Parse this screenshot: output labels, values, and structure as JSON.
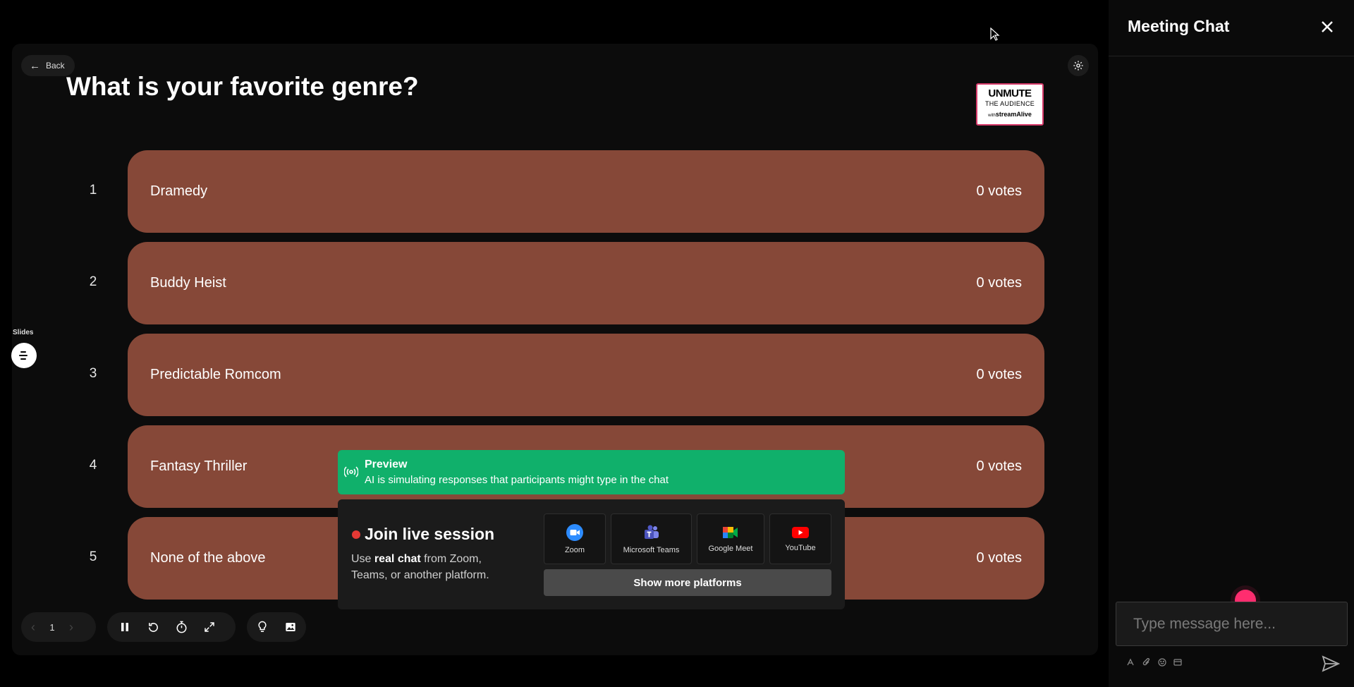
{
  "presentation": {
    "back_label": "Back",
    "question": "What is your favorite genre?",
    "logo": {
      "line1": "UNMUTE",
      "line2": "THE AUDIENCE",
      "line3_prefix": "with",
      "line3": "streamAlive"
    },
    "options": [
      {
        "number": "1",
        "label": "Dramedy",
        "votes": "0 votes"
      },
      {
        "number": "2",
        "label": "Buddy Heist",
        "votes": "0 votes"
      },
      {
        "number": "3",
        "label": "Predictable Romcom",
        "votes": "0 votes"
      },
      {
        "number": "4",
        "label": "Fantasy Thriller",
        "votes": "0 votes"
      },
      {
        "number": "5",
        "label": "None of the above",
        "votes": "0 votes"
      }
    ],
    "slides_label": "Slides",
    "page_number": "1"
  },
  "preview_banner": {
    "title": "Preview",
    "text": "AI is simulating responses that participants might type in the chat"
  },
  "join_panel": {
    "title": "Join live session",
    "desc_prefix": "Use ",
    "desc_bold": "real chat",
    "desc_suffix": " from Zoom, Teams, or another platform.",
    "platforms": [
      {
        "label": "Zoom",
        "icon": "zoom-icon"
      },
      {
        "label": "Microsoft Teams",
        "icon": "teams-icon"
      },
      {
        "label": "Google Meet",
        "icon": "google-meet-icon"
      },
      {
        "label": "YouTube",
        "icon": "youtube-icon"
      }
    ],
    "more_label": "Show more platforms"
  },
  "chat": {
    "title": "Meeting Chat",
    "input_placeholder": "Type message here..."
  },
  "colors": {
    "option_bar": "#864838",
    "preview_green": "#10b06b",
    "live_dot": "#e53935",
    "accent_pink": "#ff2d6f"
  }
}
